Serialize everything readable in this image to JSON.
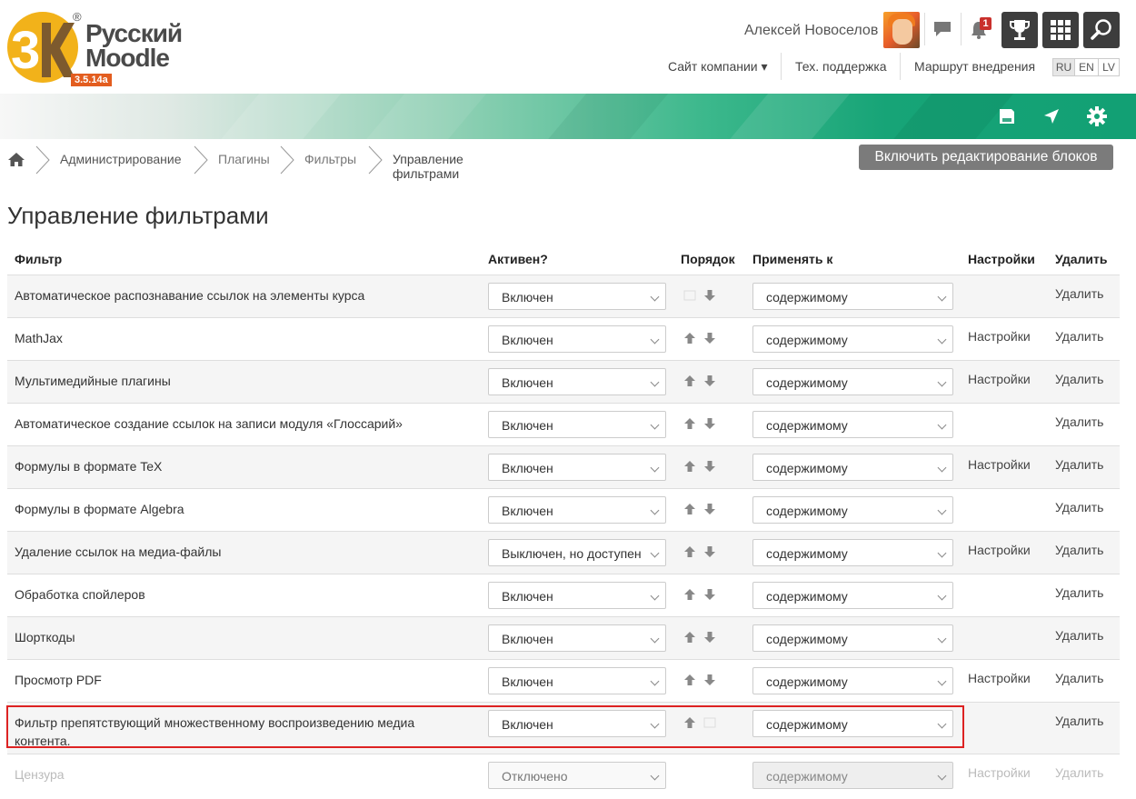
{
  "header": {
    "logo_top": "Русский",
    "logo_bottom": "Moodle",
    "logo_version": "3.5.14a",
    "user_name": "Алексей Новоселов",
    "notification_count": "1",
    "nav": {
      "company_site": "Сайт компании ▾",
      "support": "Тех. поддержка",
      "roadmap": "Маршрут внедрения"
    },
    "languages": [
      "RU",
      "EN",
      "LV"
    ],
    "active_language": "RU"
  },
  "breadcrumb": [
    "Администрирование",
    "Плагины",
    "Фильтры",
    "Управление фильтрами"
  ],
  "edit_blocks_button": "Включить редактирование блоков",
  "page_title": "Управление фильтрами",
  "table": {
    "headers": {
      "filter": "Фильтр",
      "active": "Активен?",
      "order": "Порядок",
      "apply_to": "Применять к",
      "settings": "Настройки",
      "delete": "Удалить"
    },
    "rows": [
      {
        "name": "Автоматическое распознавание ссылок на элементы курса",
        "active": "Включен",
        "apply": "содержимому",
        "settings": "",
        "delete": "Удалить",
        "up": false,
        "down": true
      },
      {
        "name": "MathJax",
        "active": "Включен",
        "apply": "содержимому",
        "settings": "Настройки",
        "delete": "Удалить",
        "up": true,
        "down": true
      },
      {
        "name": "Мультимедийные плагины",
        "active": "Включен",
        "apply": "содержимому",
        "settings": "Настройки",
        "delete": "Удалить",
        "up": true,
        "down": true
      },
      {
        "name": "Автоматическое создание ссылок на записи модуля «Глоссарий»",
        "active": "Включен",
        "apply": "содержимому",
        "settings": "",
        "delete": "Удалить",
        "up": true,
        "down": true
      },
      {
        "name": "Формулы в формате TeX",
        "active": "Включен",
        "apply": "содержимому",
        "settings": "Настройки",
        "delete": "Удалить",
        "up": true,
        "down": true
      },
      {
        "name": "Формулы в формате Algebra",
        "active": "Включен",
        "apply": "содержимому",
        "settings": "",
        "delete": "Удалить",
        "up": true,
        "down": true
      },
      {
        "name": "Удаление ссылок на медиа-файлы",
        "active": "Выключен, но доступен",
        "apply": "содержимому",
        "settings": "Настройки",
        "delete": "Удалить",
        "up": true,
        "down": true
      },
      {
        "name": "Обработка спойлеров",
        "active": "Включен",
        "apply": "содержимому",
        "settings": "",
        "delete": "Удалить",
        "up": true,
        "down": true
      },
      {
        "name": "Шорткоды",
        "active": "Включен",
        "apply": "содержимому",
        "settings": "",
        "delete": "Удалить",
        "up": true,
        "down": true
      },
      {
        "name": "Просмотр PDF",
        "active": "Включен",
        "apply": "содержимому",
        "settings": "Настройки",
        "delete": "Удалить",
        "up": true,
        "down": true
      },
      {
        "name": "Фильтр препятствующий множественному воспроизведению медиа контента.",
        "active": "Включен",
        "apply": "содержимому",
        "settings": "",
        "delete": "Удалить",
        "up": true,
        "down": false
      },
      {
        "name": "Цензура",
        "active": "Отключено",
        "apply": "содержимому",
        "settings": "Настройки",
        "delete": "Удалить",
        "up": false,
        "down": false,
        "disabled": true
      }
    ]
  }
}
